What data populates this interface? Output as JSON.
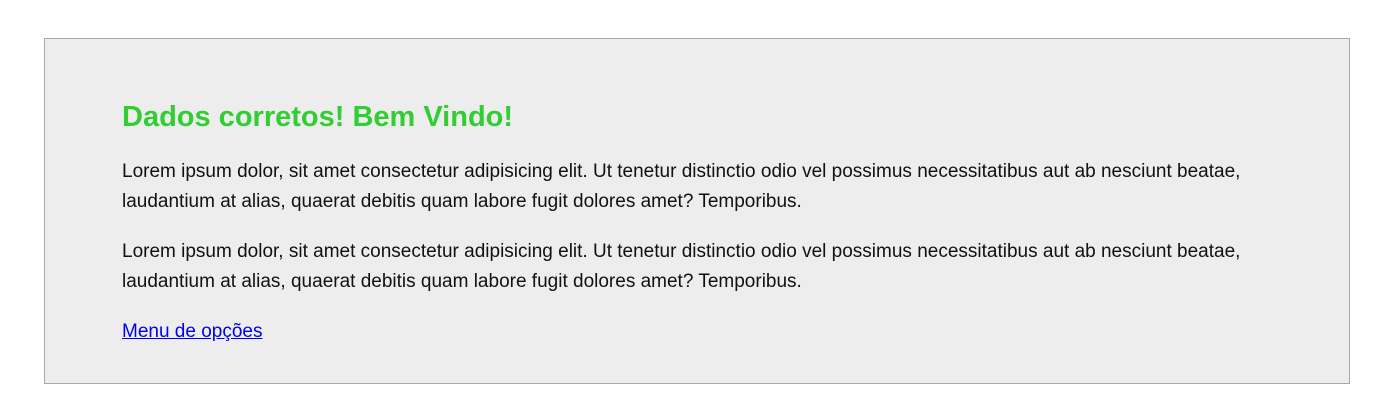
{
  "page": {
    "heading": "Dados corretos! Bem Vindo!",
    "paragraphs": [
      "Lorem ipsum dolor, sit amet consectetur adipisicing elit. Ut tenetur distinctio odio vel possimus necessitatibus aut ab nesciunt beatae, laudantium at alias, quaerat debitis quam labore fugit dolores amet? Temporibus.",
      "Lorem ipsum dolor, sit amet consectetur adipisicing elit. Ut tenetur distinctio odio vel possimus necessitatibus aut ab nesciunt beatae, laudantium at alias, quaerat debitis quam labore fugit dolores amet? Temporibus."
    ],
    "link_label": "Menu de opções"
  },
  "colors": {
    "heading": "#32cd32",
    "panel_background": "#ededed",
    "panel_border": "#a9a9a9",
    "link": "#0000ee",
    "text": "#111111"
  }
}
